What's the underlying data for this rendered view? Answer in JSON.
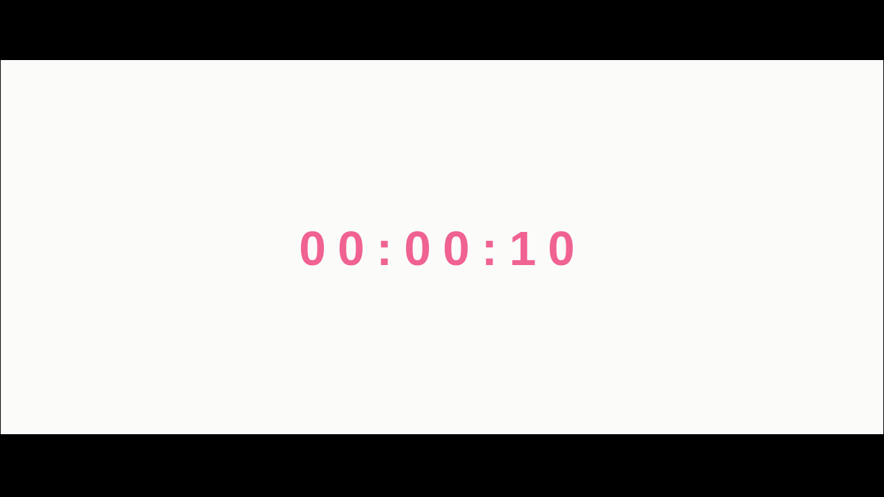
{
  "timer": {
    "display": "00:00:10",
    "color": "#f06292"
  },
  "colors": {
    "background": "#fbfcfa",
    "letterbox": "#000000"
  }
}
